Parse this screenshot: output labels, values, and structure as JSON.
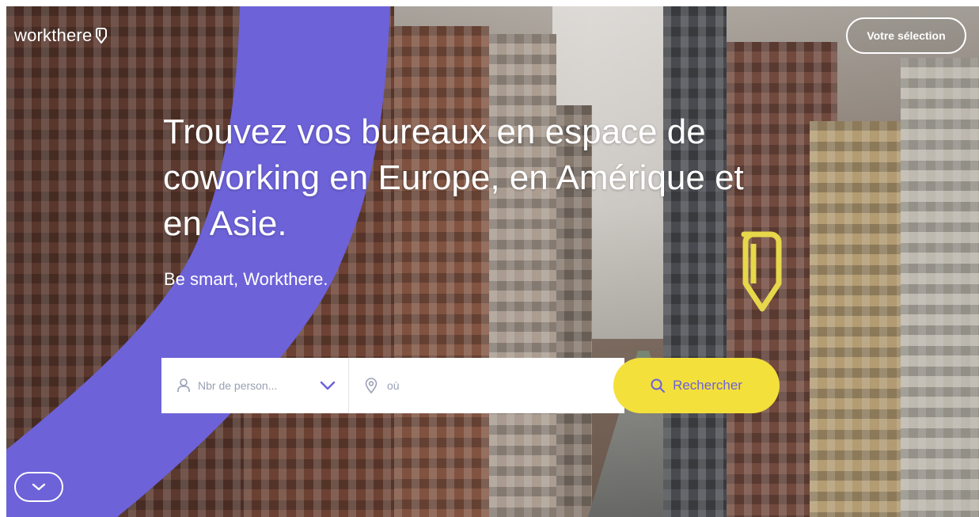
{
  "header": {
    "logo_text": "workthere",
    "selection_button": "Votre sélection"
  },
  "hero": {
    "headline": "Trouvez vos bureaux en espace de coworking en Europe, en Amérique et en Asie.",
    "tagline": "Be smart, Workthere."
  },
  "search": {
    "people_placeholder": "Nbr de person...",
    "location_placeholder": "où",
    "button_label": "Rechercher"
  },
  "icons": {
    "logo_mark": "workthere-pin-icon",
    "people": "person-icon",
    "dropdown": "chevron-down-icon",
    "location": "map-pin-icon",
    "search": "search-icon",
    "scroll": "chevron-down-icon"
  },
  "colors": {
    "accent_purple": "#6d62d8",
    "accent_yellow": "#f4e03b",
    "white": "#ffffff"
  }
}
